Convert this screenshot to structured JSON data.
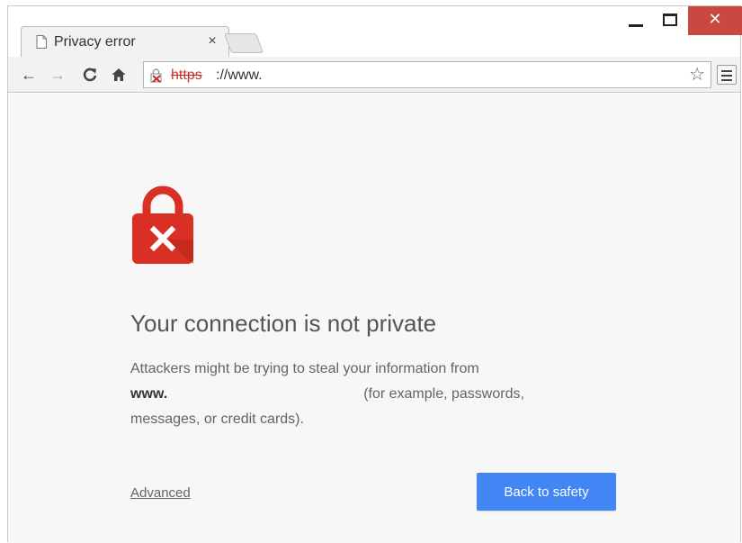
{
  "tab": {
    "title": "Privacy error",
    "close_glyph": "×",
    "icon": "document-icon"
  },
  "window_controls": {
    "close_glyph": "✕"
  },
  "toolbar": {
    "back_glyph": "←",
    "forward_glyph": "→",
    "reload_glyph": "C",
    "home_glyph": "⌂",
    "url_scheme": "https",
    "url_rest": "://www.",
    "bookmark_glyph": "☆"
  },
  "error": {
    "heading": "Your connection is not private",
    "line1": "Attackers might be trying to steal your information from",
    "domain": "www.",
    "line2_rest": "(for example, passwords,",
    "line3": "messages, or credit cards).",
    "advanced_label": "Advanced",
    "back_button_label": "Back to safety"
  },
  "colors": {
    "accent_button": "#4285f4",
    "lock_red": "#d93025",
    "close_button": "#c9483f"
  }
}
